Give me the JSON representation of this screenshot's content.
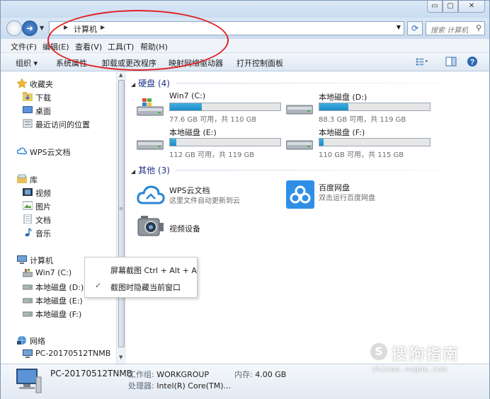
{
  "window": {
    "min": "▭",
    "max": "▢",
    "close": "✕"
  },
  "address": {
    "crumb": "计算机",
    "search_placeholder": "搜索 计算机"
  },
  "menubar": [
    {
      "label": "文件(F)"
    },
    {
      "label": "编辑(E)"
    },
    {
      "label": "查看(V)"
    },
    {
      "label": "工具(T)"
    },
    {
      "label": "帮助(H)"
    }
  ],
  "cmdbar": {
    "organize": "组织 ▾",
    "system_props": "系统属性",
    "uninstall": "卸载或更改程序",
    "map_drive": "映射网络驱动器",
    "control_panel": "打开控制面板"
  },
  "nav": {
    "favorites": "收藏夹",
    "downloads": "下载",
    "desktop": "桌面",
    "recent": "最近访问的位置",
    "wps": "WPS云文档",
    "library": "库",
    "videos": "视频",
    "pictures": "图片",
    "documents": "文档",
    "music": "音乐",
    "computer": "计算机",
    "win7c": "Win7 (C:)",
    "disk_d": "本地磁盘 (D:)",
    "disk_e": "本地磁盘 (E:)",
    "disk_f": "本地磁盘 (F:)",
    "network": "网络",
    "pc": "PC-20170512TNMB"
  },
  "content": {
    "drives_header": "硬盘 (4)",
    "drives": [
      {
        "name": "Win7 (C:)",
        "info": "77.6 GB 可用，共 110 GB",
        "used": 0.29
      },
      {
        "name": "本地磁盘 (D:)",
        "info": "88.3 GB 可用，共 119 GB",
        "used": 0.26
      },
      {
        "name": "本地磁盘 (E:)",
        "info": "112 GB 可用，共 119 GB",
        "used": 0.06
      },
      {
        "name": "本地磁盘 (F:)",
        "info": "110 GB 可用，共 115 GB",
        "used": 0.04
      }
    ],
    "other_header": "其他 (3)",
    "other": [
      {
        "name": "WPS云文档",
        "sub": "这里文件自动更新到云"
      },
      {
        "name": "百度网盘",
        "sub": "双击运行百度网盘"
      },
      {
        "name": "视频设备",
        "sub": ""
      }
    ]
  },
  "popup": {
    "item1": "屏幕截图 Ctrl + Alt + A",
    "item2": "截图时隐藏当前窗口",
    "check": "✓"
  },
  "details": {
    "pcname": "PC-20170512TNMB",
    "workgroup_k": "工作组:",
    "workgroup_v": "WORKGROUP",
    "memory_k": "内存:",
    "memory_v": "4.00 GB",
    "cpu_k": "处理器:",
    "cpu_v": "Intel(R) Core(TM)..."
  },
  "watermark": {
    "logo": "S",
    "brand": "搜狗指南",
    "url": "zhinan.sogou.com"
  }
}
